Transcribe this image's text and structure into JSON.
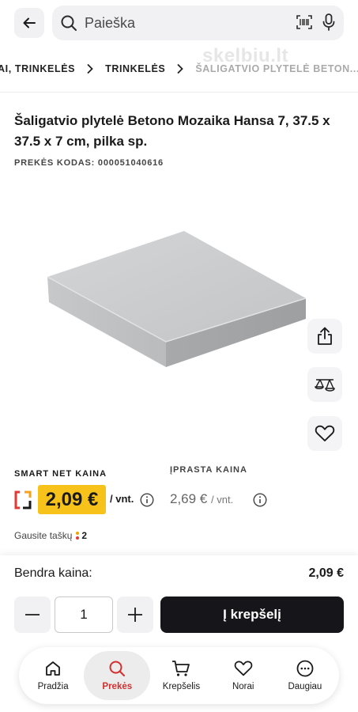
{
  "header": {
    "search_placeholder": "Paieška"
  },
  "breadcrumb": {
    "items": [
      "AI, TRINKELĖS",
      "TRINKELĖS",
      "ŠALIGATVIO PLYTELĖ BETON..."
    ]
  },
  "watermark": "skelbiu.lt",
  "product": {
    "title": "Šaligatvio plytelė Betono Mozaika Hansa 7, 37.5 x 37.5 x 7 cm, pilka sp.",
    "code": "PREKĖS KODAS: 000051040616"
  },
  "side_actions": {
    "icons": [
      "share-icon",
      "compare-icon",
      "heart-icon"
    ]
  },
  "prices": {
    "smart_label": "SMART NET KAINA",
    "smart_price": "2,09 €",
    "smart_unit": "/ vnt.",
    "regular_label": "ĮPRASTA KAINA",
    "regular_price": "2,69 €",
    "regular_unit": "/ vnt."
  },
  "points": {
    "label": "Gausite taškų",
    "value": "2"
  },
  "purchase": {
    "total_label": "Bendra kaina:",
    "total_value": "2,09 €",
    "quantity": "1",
    "add_to_cart": "Į krepšelį"
  },
  "nav": {
    "items": [
      {
        "label": "Pradžia",
        "icon": "home-icon"
      },
      {
        "label": "Prekės",
        "icon": "search-icon",
        "active": true
      },
      {
        "label": "Krepšelis",
        "icon": "cart-icon"
      },
      {
        "label": "Norai",
        "icon": "heart-icon"
      },
      {
        "label": "Daugiau",
        "icon": "more-icon"
      }
    ]
  },
  "colors": {
    "smart_price_bg": "#f7c31a",
    "active_nav": "#d32f2f",
    "cart_button": "#16161a"
  }
}
